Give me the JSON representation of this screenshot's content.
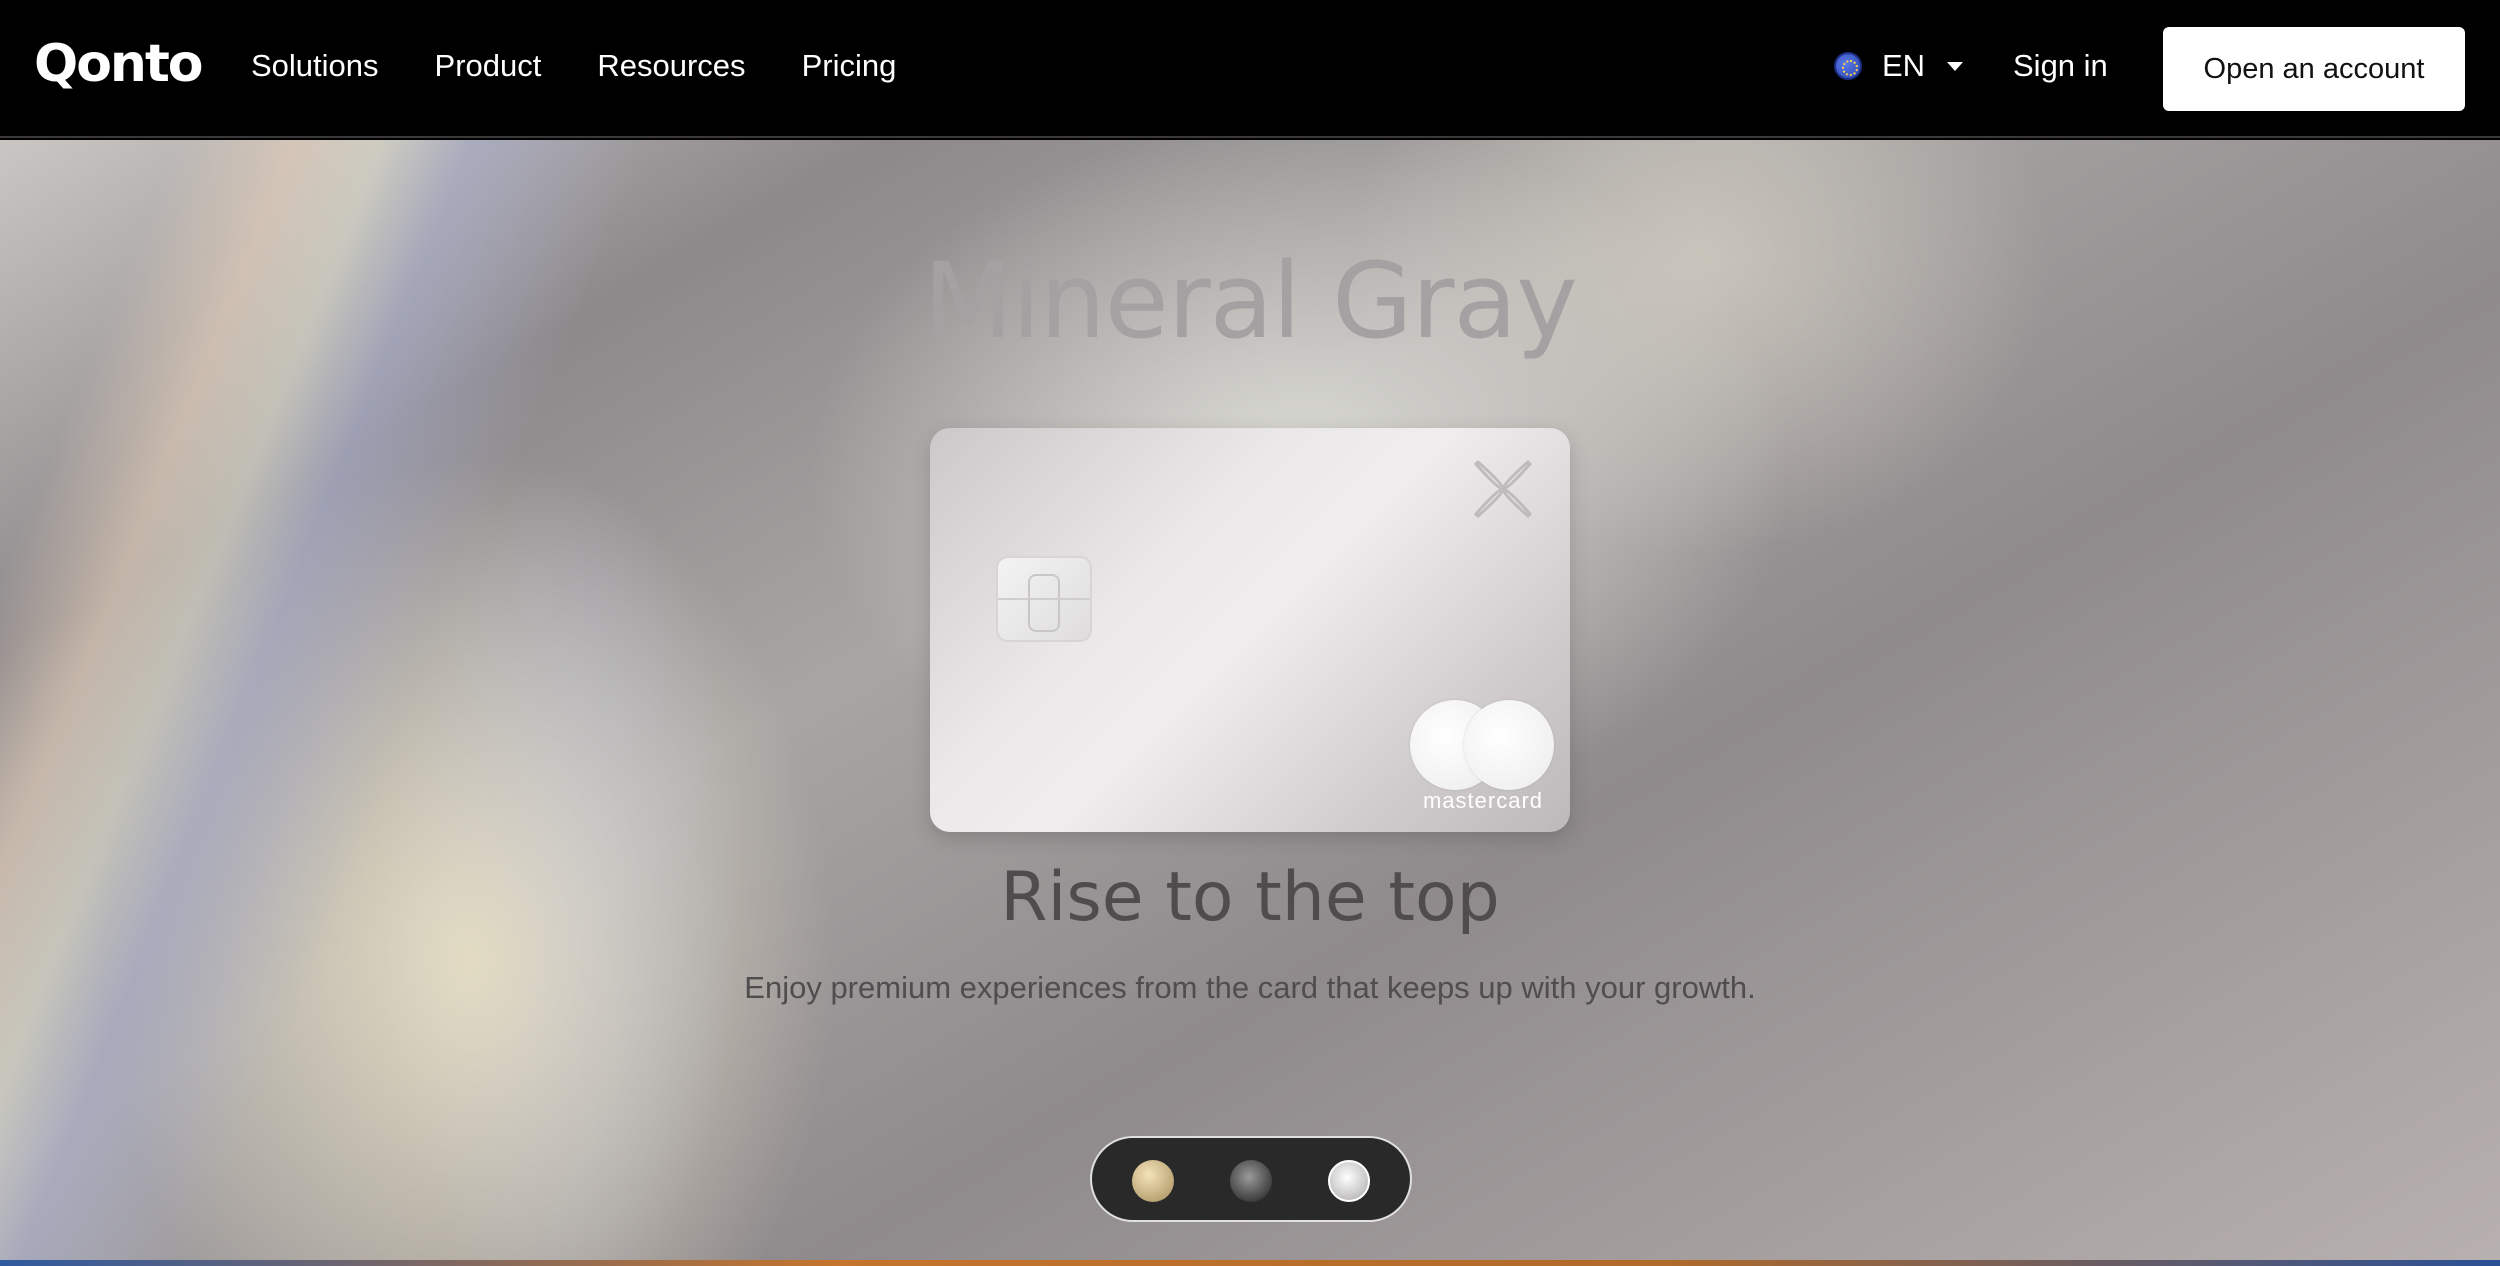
{
  "header": {
    "logo": "Qonto",
    "nav": [
      "Solutions",
      "Product",
      "Resources",
      "Pricing"
    ],
    "language": "EN",
    "sign_in": "Sign in",
    "cta": "Open an account"
  },
  "hero": {
    "card_name": "Mineral Gray",
    "card_brand": "mastercard",
    "heading": "Rise to the top",
    "subtitle": "Enjoy premium experiences from the card that keeps up with your growth.",
    "swatches": [
      "gold",
      "black",
      "silver"
    ],
    "selected_swatch": "silver"
  },
  "colors": {
    "nav_bg": "#000000",
    "cta_bg": "#ffffff",
    "title_color": "#a3a1a1",
    "heading_color": "#4e4c4c"
  }
}
